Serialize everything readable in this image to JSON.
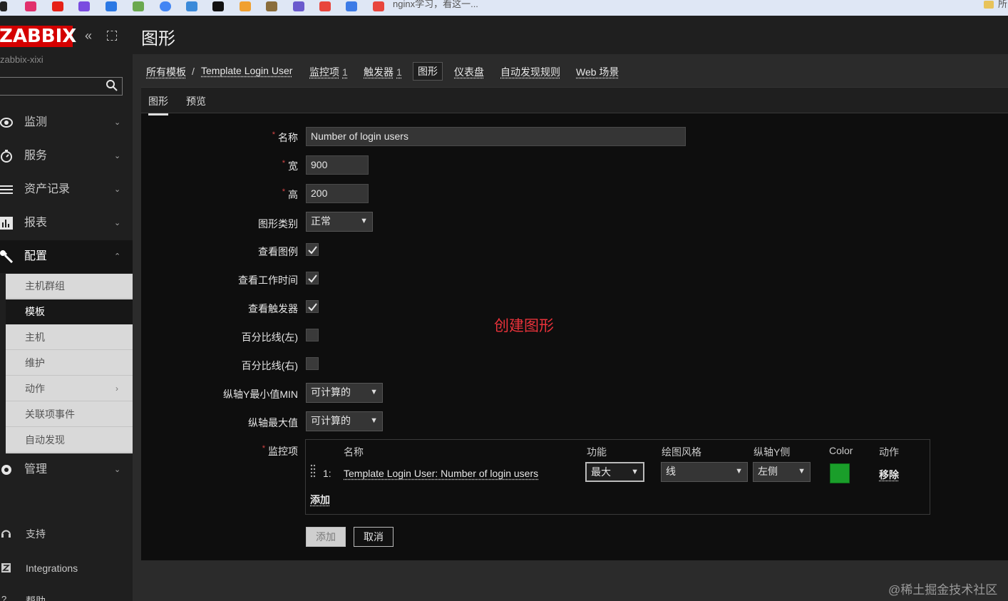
{
  "browser": {
    "bookmark_text": "nginx学习，看这一...",
    "folder_text": "所"
  },
  "sidebar": {
    "logo": "ZABBIX",
    "server_name": "zabbix-xixi",
    "menu": [
      {
        "label": "监测",
        "icon": "eye-icon"
      },
      {
        "label": "服务",
        "icon": "clock-icon"
      },
      {
        "label": "资产记录",
        "icon": "list-icon"
      },
      {
        "label": "报表",
        "icon": "bar-chart-icon"
      },
      {
        "label": "配置",
        "icon": "wrench-icon"
      }
    ],
    "submenu": [
      {
        "label": "主机群组"
      },
      {
        "label": "模板"
      },
      {
        "label": "主机"
      },
      {
        "label": "维护"
      },
      {
        "label": "动作"
      },
      {
        "label": "关联项事件"
      },
      {
        "label": "自动发现"
      }
    ],
    "admin": {
      "label": "管理",
      "icon": "gear-icon"
    },
    "bottom": [
      {
        "label": "支持",
        "icon": "headset-icon"
      },
      {
        "label": "Integrations",
        "icon": "zabbix-z-icon"
      },
      {
        "label": "帮助",
        "icon": "question-icon"
      }
    ]
  },
  "header": {
    "title": "图形"
  },
  "breadcrumb": {
    "all_templates": "所有模板",
    "separator": "/",
    "template": "Template Login User",
    "items": "监控项",
    "items_count": "1",
    "triggers": "触发器",
    "triggers_count": "1",
    "graphs": "图形",
    "dashboards": "仪表盘",
    "discovery": "自动发现规则",
    "web": "Web 场景"
  },
  "tabs": {
    "graph": "图形",
    "preview": "预览"
  },
  "form": {
    "name_label": "名称",
    "name_value": "Number of login users",
    "width_label": "宽",
    "width_value": "900",
    "height_label": "高",
    "height_value": "200",
    "graph_type_label": "图形类别",
    "graph_type_value": "正常",
    "show_legend_label": "查看图例",
    "show_legend": true,
    "show_work_period_label": "查看工作时间",
    "show_work_period": true,
    "show_triggers_label": "查看触发器",
    "show_triggers": true,
    "percentile_left_label": "百分比线(左)",
    "percentile_left": false,
    "percentile_right_label": "百分比线(右)",
    "percentile_right": false,
    "ymin_label": "纵轴Y最小值MIN",
    "ymin_value": "可计算的",
    "ymax_label": "纵轴最大值",
    "ymax_value": "可计算的",
    "items_label": "监控项"
  },
  "items_table": {
    "headers": {
      "name": "名称",
      "function": "功能",
      "draw_style": "绘图风格",
      "y_axis_side": "纵轴Y侧",
      "color": "Color",
      "action": "动作"
    },
    "rows": [
      {
        "num": "1:",
        "name": "Template Login User: Number of login users",
        "function": "最大",
        "draw_style": "线",
        "y_axis_side": "左侧",
        "color": "#1a9e2a",
        "action": "移除"
      }
    ],
    "add_link": "添加"
  },
  "buttons": {
    "add": "添加",
    "cancel": "取消"
  },
  "annotation": "创建图形",
  "watermark": "@稀土掘金技术社区"
}
